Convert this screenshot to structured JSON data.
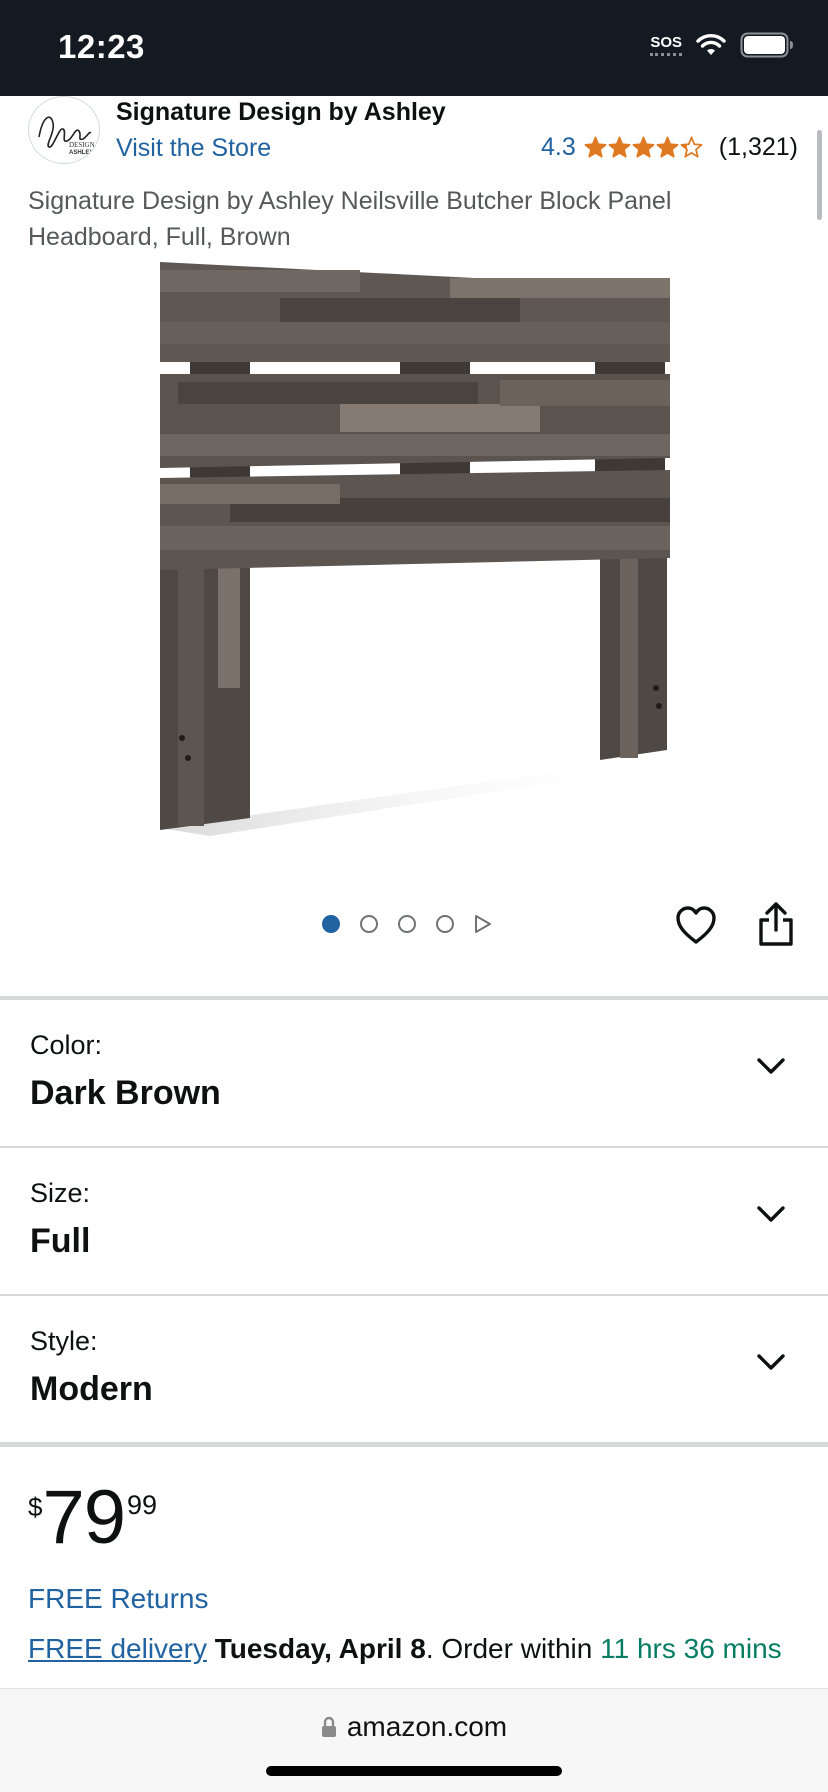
{
  "status_bar": {
    "time": "12:23",
    "sos": "SOS",
    "icons": [
      "wifi-icon",
      "battery-icon"
    ]
  },
  "store": {
    "logo_icon": "signature-design-logo",
    "name": "Signature Design by Ashley",
    "visit_link": "Visit the Store",
    "rating": "4.3",
    "stars_filled": 4.3,
    "review_count": "(1,321)"
  },
  "product": {
    "title": "Signature Design by Ashley Neilsville Butcher Block Panel Headboard, Full, Brown",
    "image_icon": "headboard-product-image"
  },
  "carousel": {
    "total_images": 4,
    "active_index": 0,
    "icons": [
      "heart-icon",
      "share-icon"
    ]
  },
  "variations": [
    {
      "label": "Color:",
      "value": "Dark Brown"
    },
    {
      "label": "Size:",
      "value": "Full"
    },
    {
      "label": "Style:",
      "value": "Modern"
    }
  ],
  "price": {
    "symbol": "$",
    "whole": "79",
    "fraction": "99"
  },
  "returns": "FREE Returns",
  "delivery": {
    "link": "FREE delivery",
    "date": "Tuesday, April 8",
    "text": ". Order within ",
    "countdown": "11 hrs 36 mins"
  },
  "browser": {
    "url": "amazon.com",
    "lock_icon": "lock-icon"
  },
  "colors": {
    "link": "#2162a1",
    "star": "#de7921",
    "countdown": "#067d62",
    "status_bar": "#131a22"
  }
}
